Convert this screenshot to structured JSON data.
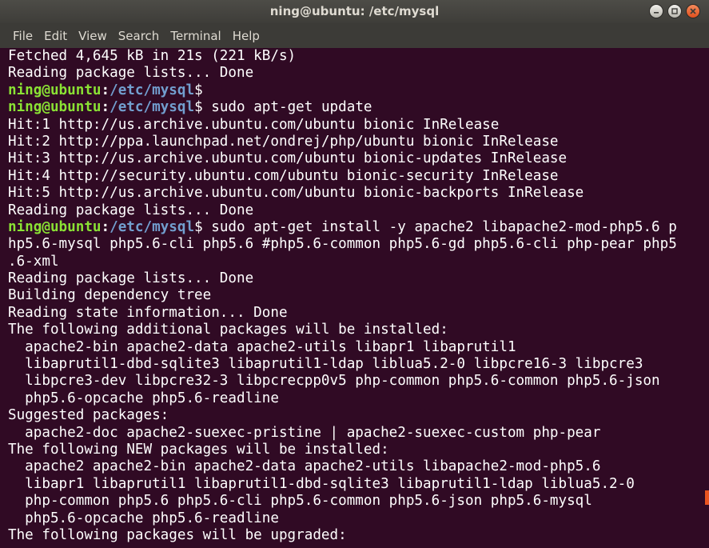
{
  "window": {
    "title": "ning@ubuntu: /etc/mysql"
  },
  "menu": {
    "items": [
      "File",
      "Edit",
      "View",
      "Search",
      "Terminal",
      "Help"
    ]
  },
  "colors": {
    "background": "#300a24",
    "prompt_user": "#8ae234",
    "prompt_path": "#729fcf",
    "scroll_thumb": "#e95420"
  },
  "terminal": {
    "lines": [
      {
        "text": "Fetched 4,645 kB in 21s (221 kB/s)"
      },
      {
        "text": "Reading package lists... Done"
      },
      {
        "prompt": {
          "user": "ning@ubuntu",
          "sep": ":",
          "path": "/etc/mysql"
        },
        "text": "$"
      },
      {
        "prompt": {
          "user": "ning@ubuntu",
          "sep": ":",
          "path": "/etc/mysql"
        },
        "text": "$ sudo apt-get update"
      },
      {
        "text": "Hit:1 http://us.archive.ubuntu.com/ubuntu bionic InRelease"
      },
      {
        "text": "Hit:2 http://ppa.launchpad.net/ondrej/php/ubuntu bionic InRelease"
      },
      {
        "text": "Hit:3 http://us.archive.ubuntu.com/ubuntu bionic-updates InRelease"
      },
      {
        "text": "Hit:4 http://security.ubuntu.com/ubuntu bionic-security InRelease"
      },
      {
        "text": "Hit:5 http://us.archive.ubuntu.com/ubuntu bionic-backports InRelease"
      },
      {
        "text": "Reading package lists... Done"
      },
      {
        "prompt": {
          "user": "ning@ubuntu",
          "sep": ":",
          "path": "/etc/mysql"
        },
        "text": "$ sudo apt-get install -y apache2 libapache2-mod-php5.6 p"
      },
      {
        "text": "hp5.6-mysql php5.6-cli php5.6 #php5.6-common php5.6-gd php5.6-cli php-pear php5"
      },
      {
        "text": ".6-xml"
      },
      {
        "text": "Reading package lists... Done"
      },
      {
        "text": "Building dependency tree"
      },
      {
        "text": "Reading state information... Done"
      },
      {
        "text": "The following additional packages will be installed:"
      },
      {
        "text": "  apache2-bin apache2-data apache2-utils libapr1 libaprutil1"
      },
      {
        "text": "  libaprutil1-dbd-sqlite3 libaprutil1-ldap liblua5.2-0 libpcre16-3 libpcre3"
      },
      {
        "text": "  libpcre3-dev libpcre32-3 libpcrecpp0v5 php-common php5.6-common php5.6-json"
      },
      {
        "text": "  php5.6-opcache php5.6-readline"
      },
      {
        "text": "Suggested packages:"
      },
      {
        "text": "  apache2-doc apache2-suexec-pristine | apache2-suexec-custom php-pear"
      },
      {
        "text": "The following NEW packages will be installed:"
      },
      {
        "text": "  apache2 apache2-bin apache2-data apache2-utils libapache2-mod-php5.6"
      },
      {
        "text": "  libapr1 libaprutil1 libaprutil1-dbd-sqlite3 libaprutil1-ldap liblua5.2-0"
      },
      {
        "text": "  php-common php5.6 php5.6-cli php5.6-common php5.6-json php5.6-mysql"
      },
      {
        "text": "  php5.6-opcache php5.6-readline"
      },
      {
        "text": "The following packages will be upgraded:"
      }
    ]
  }
}
